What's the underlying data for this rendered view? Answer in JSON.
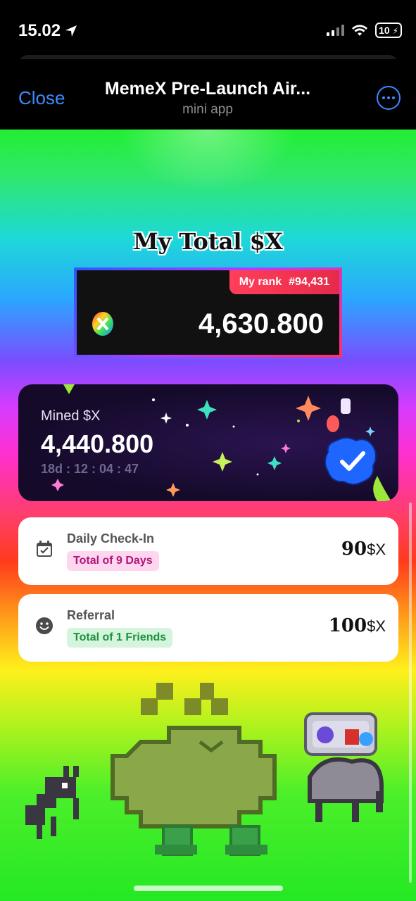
{
  "status_bar": {
    "time": "15.02",
    "battery": "10"
  },
  "header": {
    "close_label": "Close",
    "title": "MemeX Pre-Launch Air...",
    "subtitle": "mini app"
  },
  "total": {
    "heading": "My Total $X",
    "rank_label": "My rank",
    "rank_value": "#94,431",
    "value": "4,630.800"
  },
  "mined": {
    "label": "Mined $X",
    "value": "4,440.800",
    "timer": "18d : 12 : 04 : 47"
  },
  "checkin": {
    "label": "Daily Check-In",
    "badge": "Total of 9 Days",
    "amount": "90",
    "unit": "$X"
  },
  "referral": {
    "label": "Referral",
    "badge": "Total of 1 Friends",
    "amount": "100",
    "unit": "$X"
  },
  "colors": {
    "link_blue": "#3d8bff",
    "rank_red": "#e62a4a",
    "pink_badge": "#ffd6ef",
    "green_badge": "#d4f5dc"
  },
  "icons": [
    "location-arrow-icon",
    "signal-icon",
    "wifi-icon",
    "battery-icon",
    "more-icon",
    "token-icon",
    "verified-badge-icon",
    "calendar-check-icon",
    "smiley-icon"
  ]
}
